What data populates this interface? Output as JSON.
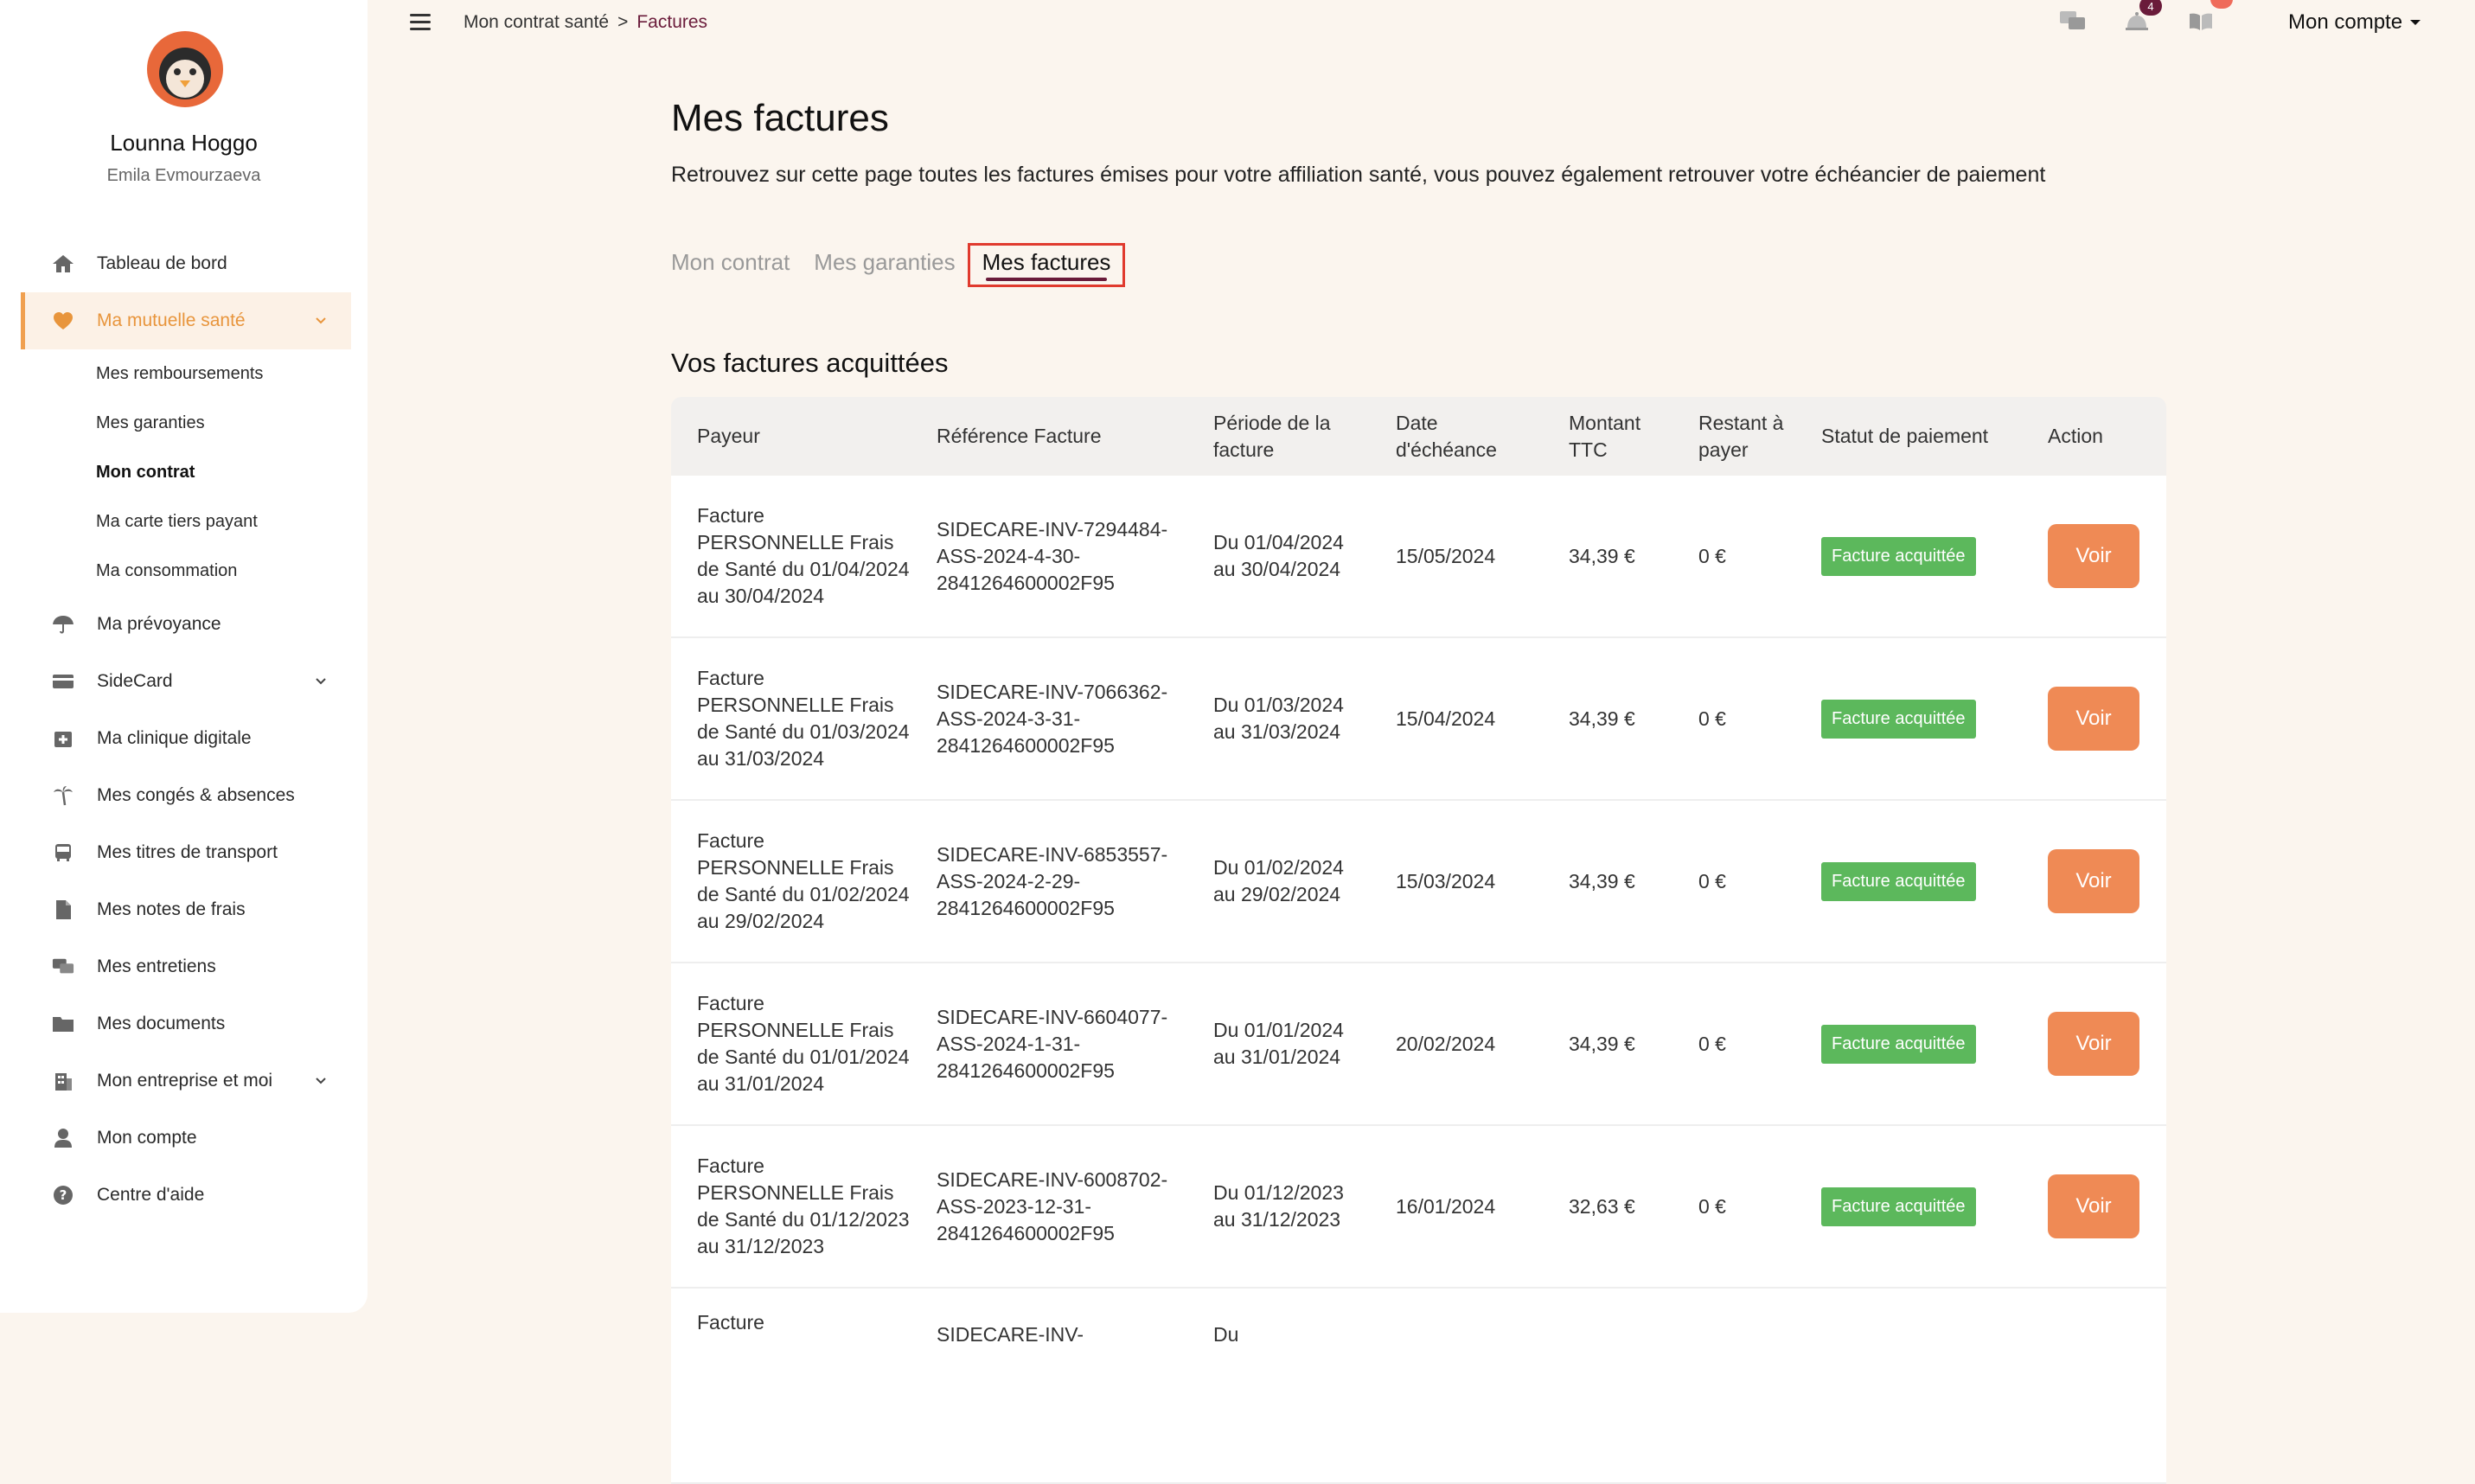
{
  "user": {
    "name": "Lounna Hoggo",
    "subtitle": "Emila Evmourzaeva"
  },
  "sidebar": {
    "items": [
      {
        "label": "Tableau de bord",
        "icon": "home-icon"
      },
      {
        "label": "Ma mutuelle santé",
        "icon": "heart-icon",
        "active": true,
        "expanded": true
      },
      {
        "label": "Ma prévoyance",
        "icon": "umbrella-icon"
      },
      {
        "label": "SideCard",
        "icon": "card-icon",
        "has_children": true
      },
      {
        "label": "Ma clinique digitale",
        "icon": "clinic-icon"
      },
      {
        "label": "Mes congés & absences",
        "icon": "palm-tree-icon"
      },
      {
        "label": "Mes titres de transport",
        "icon": "bus-icon"
      },
      {
        "label": "Mes notes de frais",
        "icon": "document-icon"
      },
      {
        "label": "Mes entretiens",
        "icon": "chat-icon"
      },
      {
        "label": "Mes documents",
        "icon": "folder-icon"
      },
      {
        "label": "Mon entreprise et moi",
        "icon": "building-icon",
        "has_children": true
      },
      {
        "label": "Mon compte",
        "icon": "user-icon"
      },
      {
        "label": "Centre d'aide",
        "icon": "help-icon"
      }
    ],
    "subitems": [
      {
        "label": "Mes remboursements"
      },
      {
        "label": "Mes garanties"
      },
      {
        "label": "Mon contrat",
        "current": true
      },
      {
        "label": "Ma carte tiers payant"
      },
      {
        "label": "Ma consommation"
      }
    ]
  },
  "breadcrumb": {
    "parent": "Mon contrat santé",
    "separator": ">",
    "current": "Factures"
  },
  "topbar": {
    "account_label": "Mon compte",
    "notification_badge": "4"
  },
  "main": {
    "title": "Mes factures",
    "description": "Retrouvez sur cette page toutes les factures émises pour votre affiliation santé, vous pouvez également retrouver votre échéancier de paiement",
    "tabs": [
      {
        "label": "Mon contrat"
      },
      {
        "label": "Mes garanties"
      },
      {
        "label": "Mes factures",
        "active": true
      }
    ],
    "section_title": "Vos factures acquittées",
    "columns": [
      "Payeur",
      "Référence Facture",
      "Période de la facture",
      "Date d'échéance",
      "Montant TTC",
      "Restant à payer",
      "Statut de paiement",
      "Action"
    ],
    "rows": [
      {
        "payer": "Facture PERSONNELLE Frais de Santé du 01/04/2024 au 30/04/2024",
        "reference": "SIDECARE-INV-7294484-ASS-2024-4-30-2841264600002F95",
        "period": "Du 01/04/2024 au 30/04/2024",
        "due_date": "15/05/2024",
        "amount": "34,39 €",
        "remaining": "0 €",
        "status": "Facture acquittée",
        "action": "Voir"
      },
      {
        "payer": "Facture PERSONNELLE Frais de Santé du 01/03/2024 au 31/03/2024",
        "reference": "SIDECARE-INV-7066362-ASS-2024-3-31-2841264600002F95",
        "period": "Du 01/03/2024 au 31/03/2024",
        "due_date": "15/04/2024",
        "amount": "34,39 €",
        "remaining": "0 €",
        "status": "Facture acquittée",
        "action": "Voir"
      },
      {
        "payer": "Facture PERSONNELLE Frais de Santé du 01/02/2024 au 29/02/2024",
        "reference": "SIDECARE-INV-6853557-ASS-2024-2-29-2841264600002F95",
        "period": "Du 01/02/2024 au 29/02/2024",
        "due_date": "15/03/2024",
        "amount": "34,39 €",
        "remaining": "0 €",
        "status": "Facture acquittée",
        "action": "Voir"
      },
      {
        "payer": "Facture PERSONNELLE Frais de Santé du 01/01/2024 au 31/01/2024",
        "reference": "SIDECARE-INV-6604077-ASS-2024-1-31-2841264600002F95",
        "period": "Du 01/01/2024 au 31/01/2024",
        "due_date": "20/02/2024",
        "amount": "34,39 €",
        "remaining": "0 €",
        "status": "Facture acquittée",
        "action": "Voir"
      },
      {
        "payer": "Facture PERSONNELLE Frais de Santé du 01/12/2023 au 31/12/2023",
        "reference": "SIDECARE-INV-6008702-ASS-2023-12-31-2841264600002F95",
        "period": "Du 01/12/2023 au 31/12/2023",
        "due_date": "16/01/2024",
        "amount": "32,63 €",
        "remaining": "0 €",
        "status": "Facture acquittée",
        "action": "Voir"
      },
      {
        "payer": "Facture",
        "reference": "SIDECARE-INV-",
        "period": "Du",
        "due_date": "",
        "amount": "",
        "remaining": "",
        "status": "",
        "action": ""
      }
    ]
  },
  "colors": {
    "accent": "#ef8a55",
    "brand": "#6a1b3a",
    "success": "#5cb85c",
    "active_nav": "#e8953c"
  }
}
